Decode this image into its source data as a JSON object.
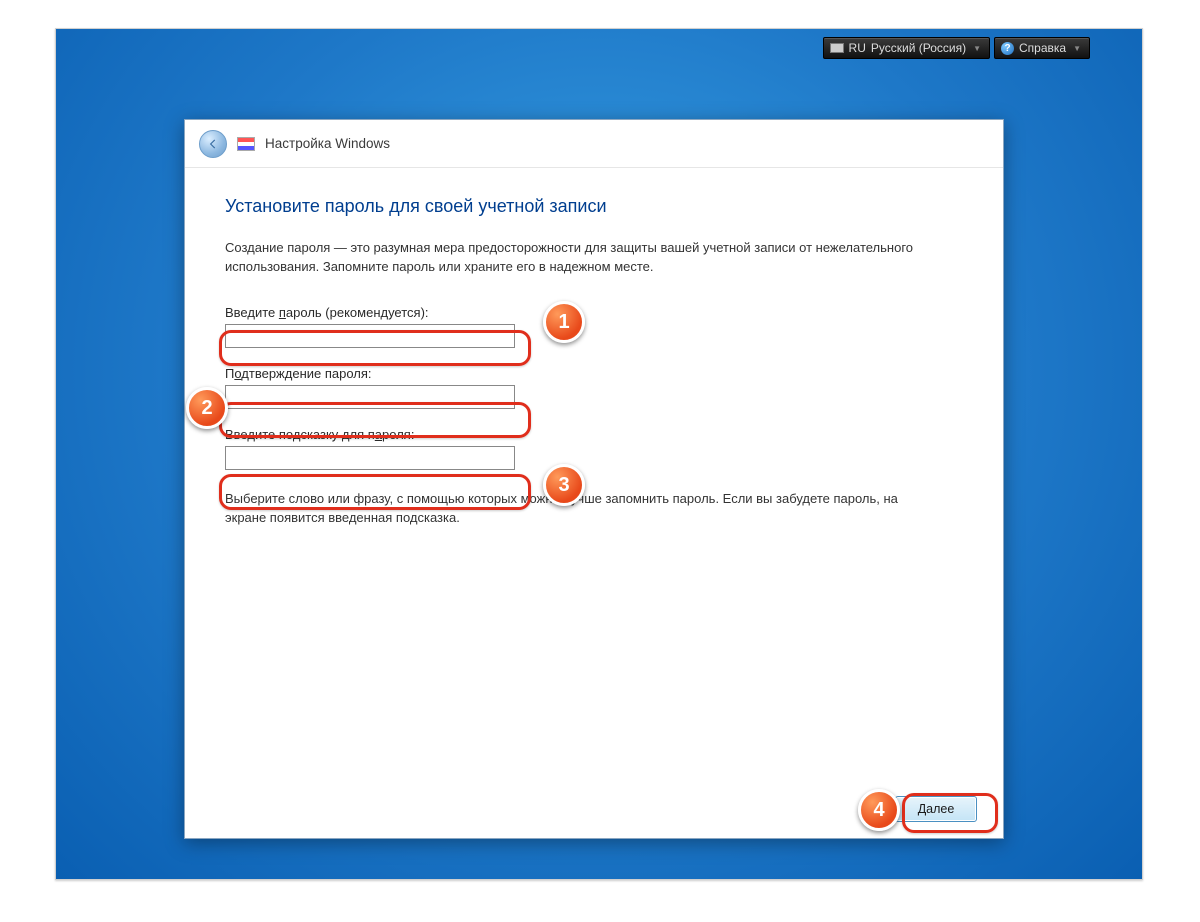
{
  "topbar": {
    "lang_code": "RU",
    "lang_name": "Русский (Россия)",
    "help_label": "Справка"
  },
  "window": {
    "title": "Настройка Windows",
    "heading": "Установите пароль для своей учетной записи",
    "description": "Создание пароля — это разумная мера предосторожности для защиты вашей учетной записи от нежелательного использования. Запомните пароль или храните его в надежном месте.",
    "fields": {
      "password": {
        "label_pre": "Введите ",
        "label_u": "п",
        "label_post": "ароль (рекомендуется):",
        "value": ""
      },
      "confirm": {
        "label_pre": "П",
        "label_u": "о",
        "label_post": "дтверждение пароля:",
        "value": ""
      },
      "hint": {
        "label_pre": "Введите подсказку для п",
        "label_u": "а",
        "label_post": "роля:",
        "value": ""
      }
    },
    "hint_description": "Выберите слово или фразу, с помощью которых можно лучше запомнить пароль. Если вы забудете пароль, на экране появится введенная подсказка.",
    "next_button": "Далее"
  },
  "annotations": {
    "markers": [
      {
        "n": "1"
      },
      {
        "n": "2"
      },
      {
        "n": "3"
      },
      {
        "n": "4"
      }
    ]
  }
}
